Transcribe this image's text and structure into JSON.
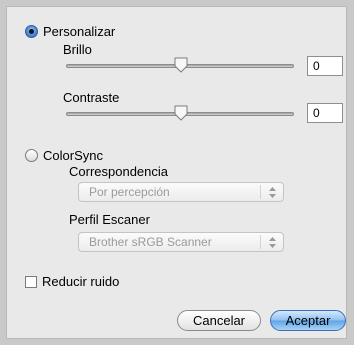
{
  "personalizar": {
    "label": "Personalizar",
    "selected": true,
    "brillo": {
      "label": "Brillo",
      "value": "0",
      "level": 0.5
    },
    "contraste": {
      "label": "Contraste",
      "value": "0",
      "level": 0.5
    }
  },
  "colorsync": {
    "label": "ColorSync",
    "selected": false,
    "correspondencia": {
      "label": "Correspondencia",
      "selected_option": "Por percepción"
    },
    "perfil": {
      "label": "Perfil Escaner",
      "selected_option": "Brother sRGB Scanner"
    }
  },
  "reducir_ruido": {
    "label": "Reducir ruido",
    "checked": false
  },
  "buttons": {
    "cancel": "Cancelar",
    "accept": "Aceptar"
  }
}
